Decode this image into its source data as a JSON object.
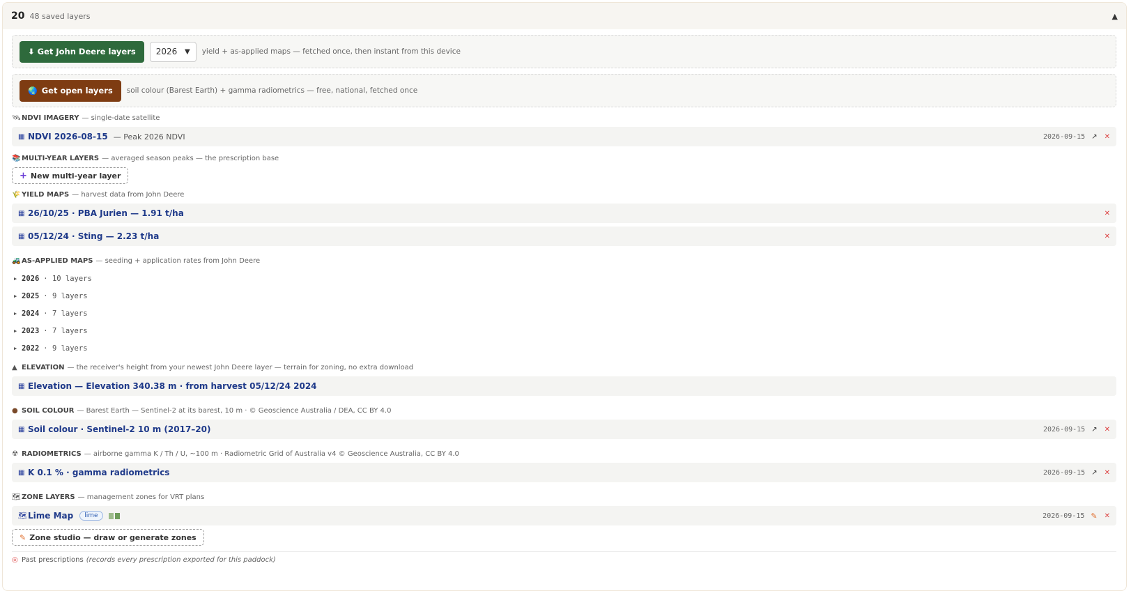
{
  "header": {
    "count": "20",
    "label": "48 saved layers",
    "collapse_icon": "▲"
  },
  "jd_box": {
    "button": "⬇ Get John Deere layers",
    "year": "2026",
    "note": "yield + as-applied maps — fetched once, then instant from this device"
  },
  "open_box": {
    "button": "Get open layers",
    "note": "soil colour (Barest Earth) + gamma radiometrics — free, national, fetched once"
  },
  "ndvi": {
    "title": "NDVI IMAGERY",
    "desc": "— single-date satellite",
    "rows": [
      {
        "name": "NDVI 2026-08-15",
        "sub": "— Peak 2026 NDVI",
        "date": "2026-09-15"
      }
    ]
  },
  "multi": {
    "title": "MULTI-YEAR LAYERS",
    "desc": "— averaged season peaks — the prescription base",
    "new_button": "New multi-year layer"
  },
  "yield": {
    "title": "YIELD MAPS",
    "desc": "— harvest data from John Deere",
    "rows": [
      {
        "name": "26/10/25 · PBA Jurien — 1.91 t/ha"
      },
      {
        "name": "05/12/24 · Sting — 2.23 t/ha"
      }
    ]
  },
  "applied": {
    "title": "AS-APPLIED MAPS",
    "desc": "— seeding + application rates from John Deere",
    "years": [
      {
        "year": "2026",
        "count": "· 10 layers"
      },
      {
        "year": "2025",
        "count": "· 9 layers"
      },
      {
        "year": "2024",
        "count": "· 7 layers"
      },
      {
        "year": "2023",
        "count": "· 7 layers"
      },
      {
        "year": "2022",
        "count": "· 9 layers"
      }
    ]
  },
  "elevation": {
    "title": "ELEVATION",
    "desc": "— the receiver's height from your newest John Deere layer — terrain for zoning, no extra download",
    "rows": [
      {
        "name": "Elevation — Elevation 340.38 m · from harvest 05/12/24 2024"
      }
    ]
  },
  "soil": {
    "title": "SOIL COLOUR",
    "desc": "— Barest Earth — Sentinel-2 at its barest, 10 m · © Geoscience Australia / DEA, CC BY 4.0",
    "rows": [
      {
        "name": "Soil colour · Sentinel-2 10 m (2017–20)",
        "date": "2026-09-15"
      }
    ]
  },
  "radio": {
    "title": "RADIOMETRICS",
    "desc": "— airborne gamma K / Th / U, ~100 m · Radiometric Grid of Australia v4 © Geoscience Australia, CC BY 4.0",
    "rows": [
      {
        "name": "K 0.1 % · gamma radiometrics",
        "date": "2026-09-15"
      }
    ]
  },
  "zones": {
    "title": "ZONE LAYERS",
    "desc": "— management zones for VRT plans",
    "rows": [
      {
        "name": "Lime Map",
        "tag": "lime",
        "date": "2026-09-15"
      }
    ],
    "swatches": [
      "#9dbb8b",
      "#6e9c5a"
    ],
    "studio_button": "Zone studio — draw or generate zones"
  },
  "past": {
    "label": "Past prescriptions",
    "note": "(records every prescription exported for this paddock)"
  },
  "colors": {
    "jd_green": "#2e6a3c",
    "open_brown": "#7e3c12",
    "link_blue": "#1f3a8a",
    "delete_red": "#d44444"
  }
}
